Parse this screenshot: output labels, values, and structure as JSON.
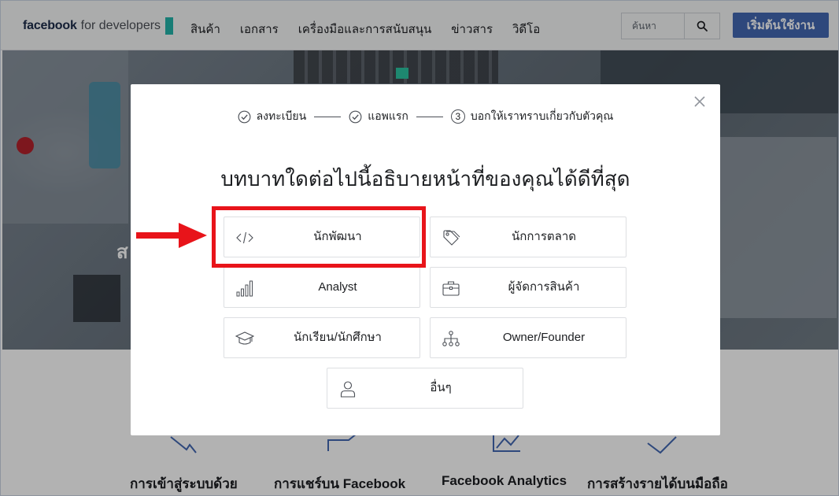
{
  "nav": {
    "logo_facebook": "facebook",
    "logo_developers": "for developers",
    "menu": [
      "สินค้า",
      "เอกสาร",
      "เครื่องมือและการสนับสนุน",
      "ข่าวสาร",
      "วิดีโอ"
    ],
    "search_placeholder": "ค้นหา",
    "start_button": "เริ่มต้นใช้งาน"
  },
  "hero": {
    "partial_text": "ส"
  },
  "bottom": {
    "titles": [
      "การเข้าสู่ระบบด้วย",
      "การแชร์บน Facebook",
      "Facebook Analytics",
      "การสร้างรายได้บนมือถือ"
    ]
  },
  "modal": {
    "steps": [
      {
        "label": "ลงทะเบียน",
        "status": "done"
      },
      {
        "label": "แอพแรก",
        "status": "done"
      },
      {
        "label": "บอกให้เราทราบเกี่ยวกับตัวคุณ",
        "status": "current",
        "number": "3"
      }
    ],
    "heading": "บทบาทใดต่อไปนี้อธิบายหน้าที่ของคุณได้ดีที่สุด",
    "roles": [
      {
        "label": "นักพัฒนา",
        "icon": "code-icon"
      },
      {
        "label": "นักการตลาด",
        "icon": "tag-icon"
      },
      {
        "label": "Analyst",
        "icon": "bar-chart-icon"
      },
      {
        "label": "ผู้จัดการสินค้า",
        "icon": "briefcase-icon"
      },
      {
        "label": "นักเรียน/นักศึกษา",
        "icon": "graduation-cap-icon"
      },
      {
        "label": "Owner/Founder",
        "icon": "org-chart-icon"
      },
      {
        "label": "อื่นๆ",
        "icon": "person-icon"
      }
    ]
  },
  "colors": {
    "brand_blue": "#4267b2",
    "logo_accent": "#23b3aa",
    "icon_blue": "#4267b2",
    "highlight_red": "#e8141a"
  }
}
